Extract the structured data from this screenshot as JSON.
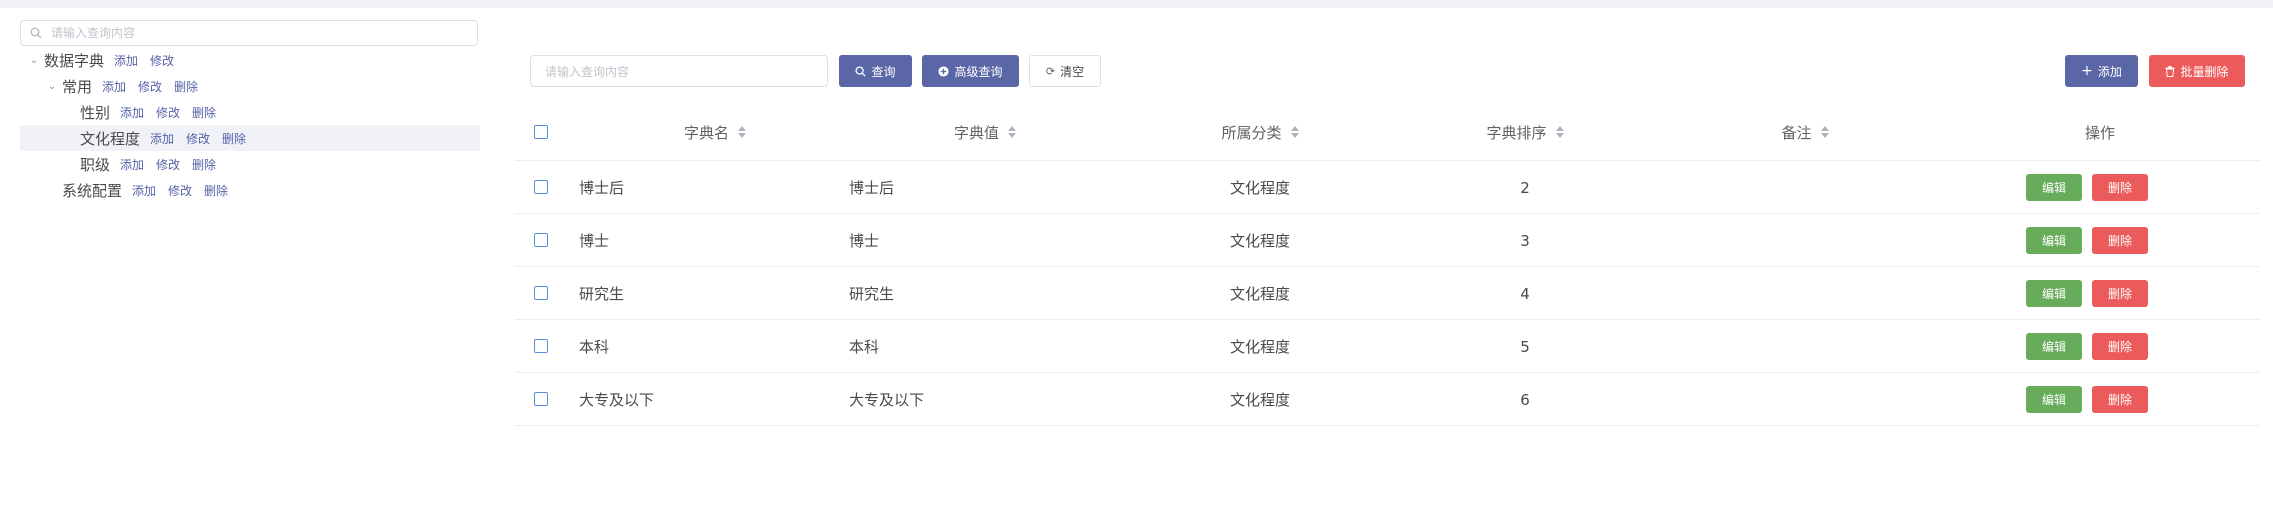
{
  "tree": {
    "search_placeholder": "请输入查询内容",
    "nodes": [
      {
        "label": "数据字典",
        "expanded": true,
        "actions": [
          "添加",
          "修改"
        ]
      },
      {
        "label": "常用",
        "expanded": true,
        "actions": [
          "添加",
          "修改",
          "删除"
        ]
      },
      {
        "label": "性别",
        "actions": [
          "添加",
          "修改",
          "删除"
        ]
      },
      {
        "label": "文化程度",
        "selected": true,
        "actions": [
          "添加",
          "修改",
          "删除"
        ]
      },
      {
        "label": "职级",
        "actions": [
          "添加",
          "修改",
          "删除"
        ]
      },
      {
        "label": "系统配置",
        "actions": [
          "添加",
          "修改",
          "删除"
        ]
      }
    ]
  },
  "toolbar": {
    "search_placeholder": "请输入查询内容",
    "query_label": "查询",
    "advanced_query_label": "高级查询",
    "clear_label": "清空",
    "add_label": "添加",
    "batch_delete_label": "批量删除"
  },
  "table": {
    "headers": {
      "name": "字典名",
      "value": "字典值",
      "category": "所属分类",
      "order": "字典排序",
      "remark": "备注",
      "ops": "操作"
    },
    "rows": [
      {
        "name": "博士后",
        "value": "博士后",
        "category": "文化程度",
        "order": "2",
        "remark": ""
      },
      {
        "name": "博士",
        "value": "博士",
        "category": "文化程度",
        "order": "3",
        "remark": ""
      },
      {
        "name": "研究生",
        "value": "研究生",
        "category": "文化程度",
        "order": "4",
        "remark": ""
      },
      {
        "name": "本科",
        "value": "本科",
        "category": "文化程度",
        "order": "5",
        "remark": ""
      },
      {
        "name": "大专及以下",
        "value": "大专及以下",
        "category": "文化程度",
        "order": "6",
        "remark": ""
      }
    ],
    "edit_label": "编辑",
    "delete_label": "删除"
  },
  "colors": {
    "primary": "#5b66a6",
    "danger": "#ec5b5b",
    "success": "#67ac5b",
    "link": "#5661a7"
  }
}
